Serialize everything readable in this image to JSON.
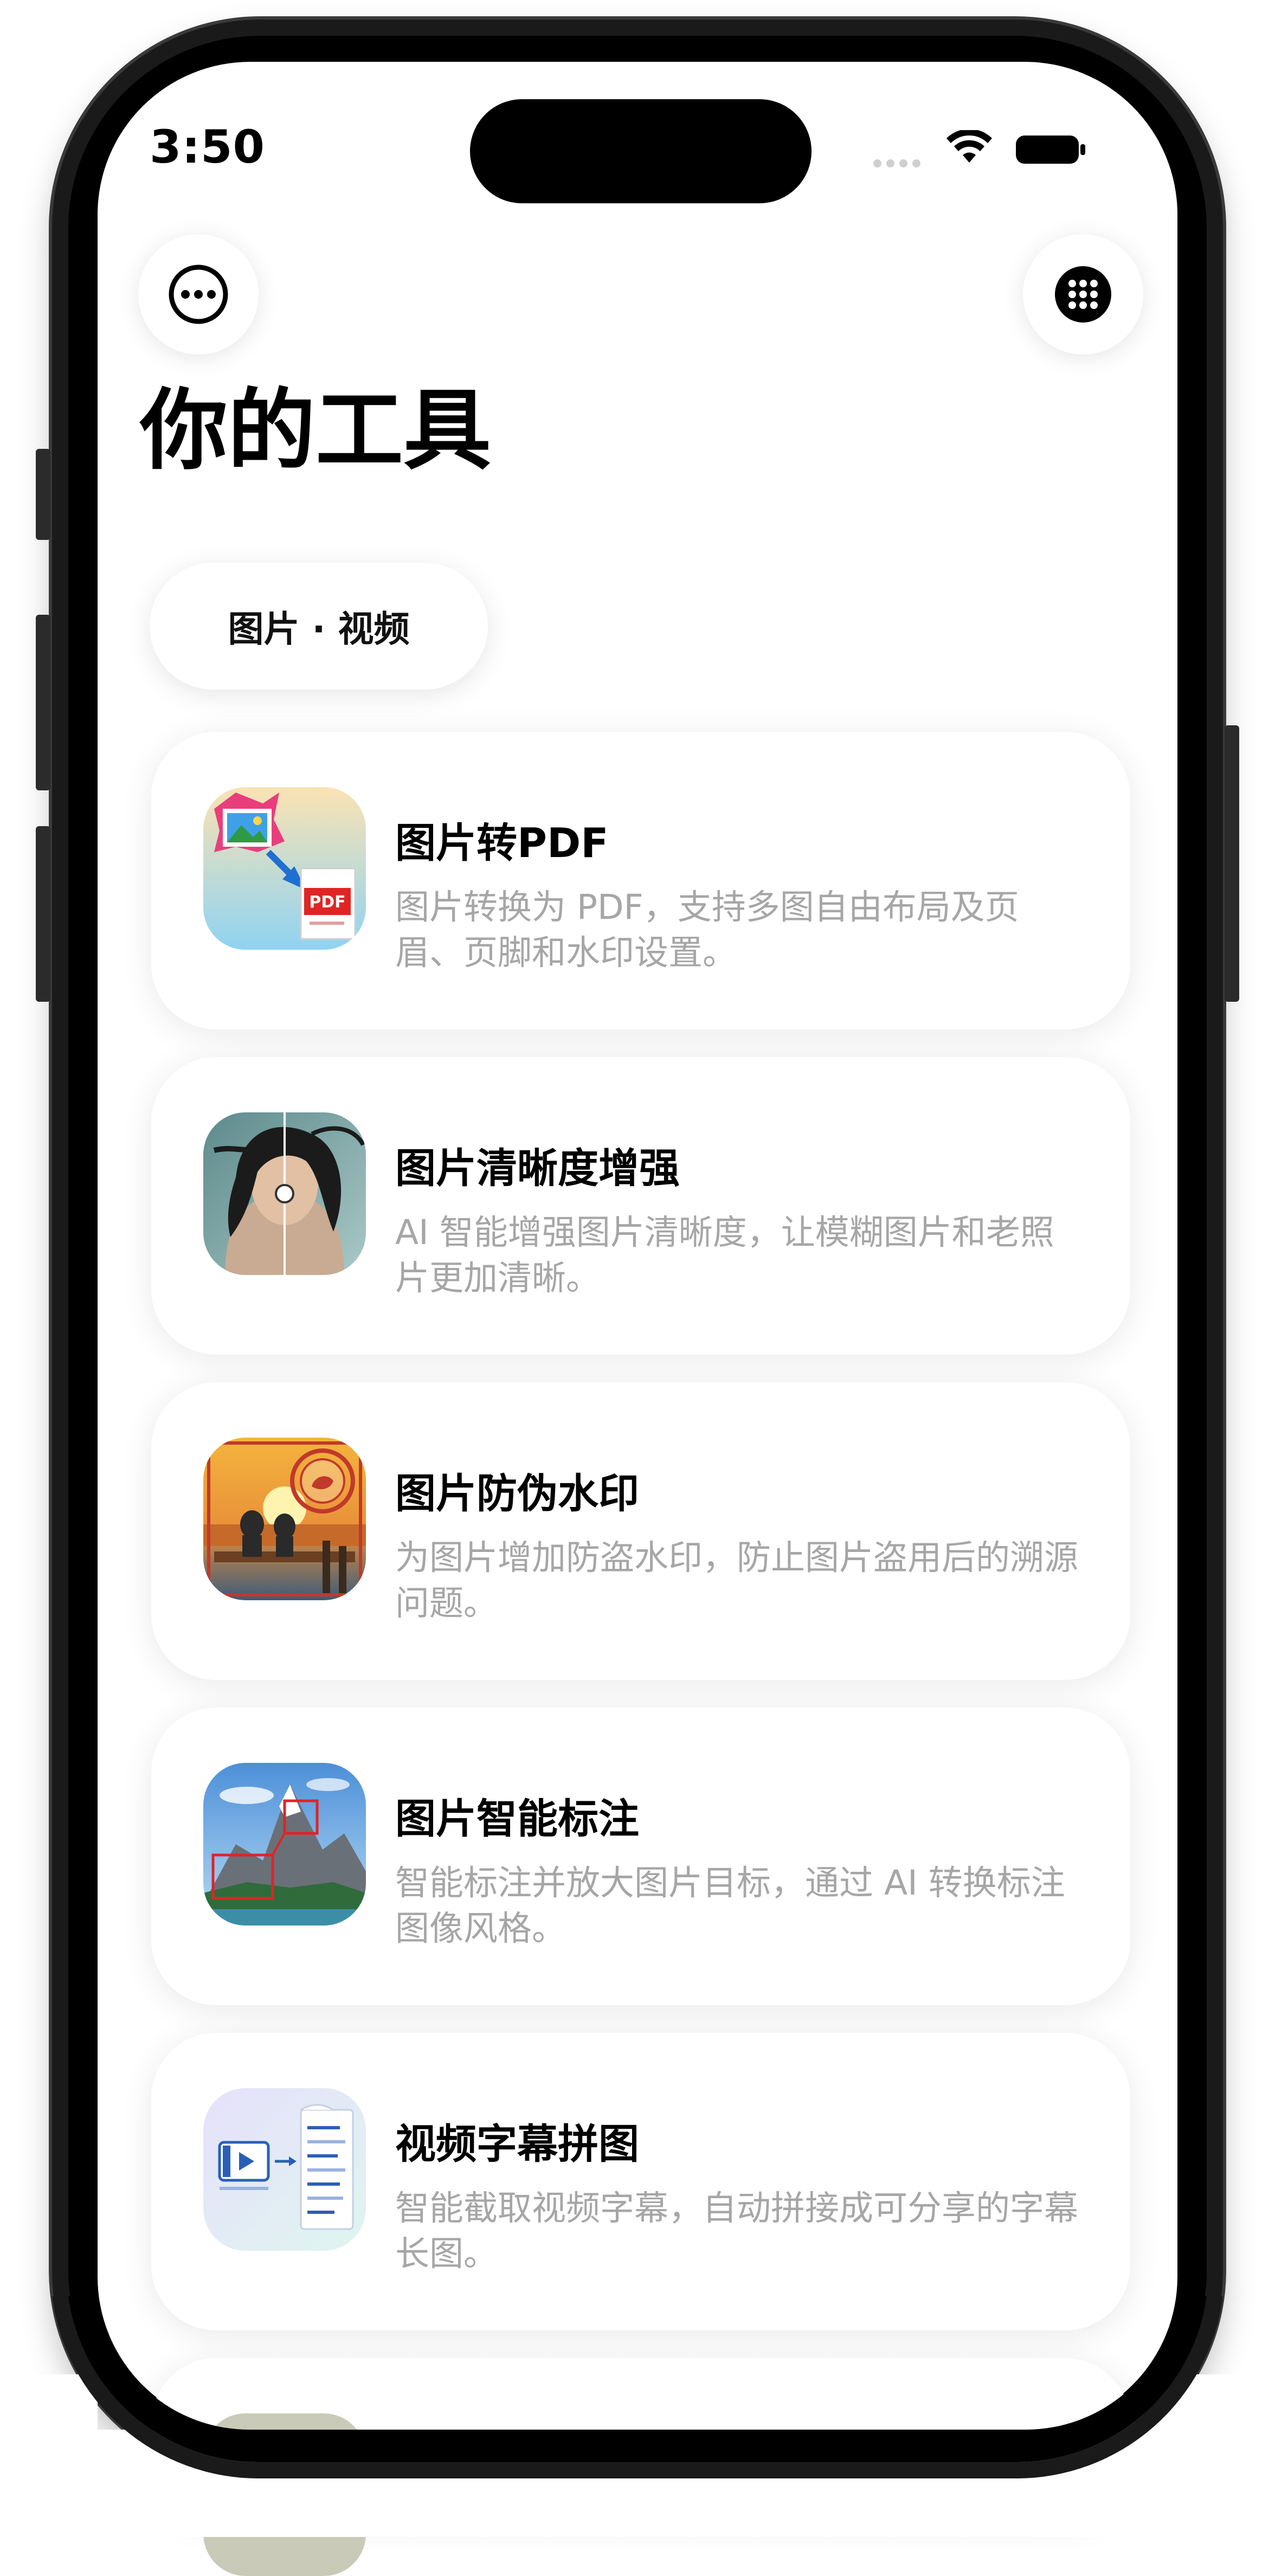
{
  "status_bar": {
    "time": "3:50",
    "wifi_icon": "wifi-icon",
    "battery_icon": "battery-icon"
  },
  "top_bar": {
    "left_button_icon": "more-horizontal-icon",
    "right_button_icon": "grid-dots-icon"
  },
  "page": {
    "title": "你的工具"
  },
  "category": {
    "label": "图片 · 视频"
  },
  "tools": [
    {
      "title": "图片转PDF",
      "description": "图片转换为 PDF，支持多图自由布局及页眉、页脚和水印设置。",
      "icon": "image-to-pdf-icon"
    },
    {
      "title": "图片清晰度增强",
      "description": "AI 智能增强图片清晰度，让模糊图片和老照片更加清晰。",
      "icon": "image-enhance-icon"
    },
    {
      "title": "图片防伪水印",
      "description": "为图片增加防盗水印，防止图片盗用后的溯源问题。",
      "icon": "image-watermark-icon"
    },
    {
      "title": "图片智能标注",
      "description": "智能标注并放大图片目标，通过 AI 转换标注图像风格。",
      "icon": "image-annotate-icon"
    },
    {
      "title": "视频字幕拼图",
      "description": "智能截取视频字幕，自动拼接成可分享的字幕长图。",
      "icon": "video-subtitle-collage-icon"
    }
  ],
  "colors": {
    "title_text": "#000000",
    "description_text": "#a6a6a6",
    "card_background": "#ffffff",
    "phone_frame": "#1a1a1a"
  }
}
